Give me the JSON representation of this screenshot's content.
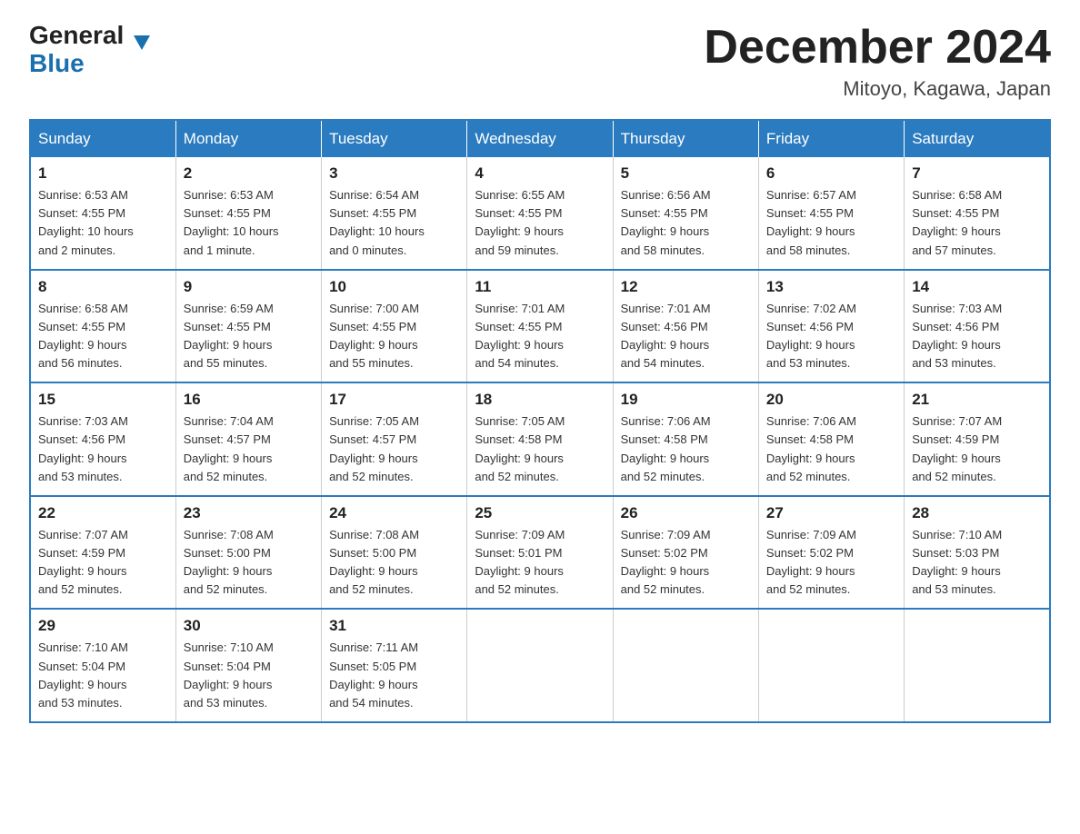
{
  "logo": {
    "general": "General",
    "blue": "Blue",
    "arrow": "▼"
  },
  "header": {
    "title": "December 2024",
    "location": "Mitoyo, Kagawa, Japan"
  },
  "days_of_week": [
    "Sunday",
    "Monday",
    "Tuesday",
    "Wednesday",
    "Thursday",
    "Friday",
    "Saturday"
  ],
  "weeks": [
    [
      {
        "day": "1",
        "sunrise": "6:53 AM",
        "sunset": "4:55 PM",
        "daylight": "10 hours and 2 minutes."
      },
      {
        "day": "2",
        "sunrise": "6:53 AM",
        "sunset": "4:55 PM",
        "daylight": "10 hours and 1 minute."
      },
      {
        "day": "3",
        "sunrise": "6:54 AM",
        "sunset": "4:55 PM",
        "daylight": "10 hours and 0 minutes."
      },
      {
        "day": "4",
        "sunrise": "6:55 AM",
        "sunset": "4:55 PM",
        "daylight": "9 hours and 59 minutes."
      },
      {
        "day": "5",
        "sunrise": "6:56 AM",
        "sunset": "4:55 PM",
        "daylight": "9 hours and 58 minutes."
      },
      {
        "day": "6",
        "sunrise": "6:57 AM",
        "sunset": "4:55 PM",
        "daylight": "9 hours and 58 minutes."
      },
      {
        "day": "7",
        "sunrise": "6:58 AM",
        "sunset": "4:55 PM",
        "daylight": "9 hours and 57 minutes."
      }
    ],
    [
      {
        "day": "8",
        "sunrise": "6:58 AM",
        "sunset": "4:55 PM",
        "daylight": "9 hours and 56 minutes."
      },
      {
        "day": "9",
        "sunrise": "6:59 AM",
        "sunset": "4:55 PM",
        "daylight": "9 hours and 55 minutes."
      },
      {
        "day": "10",
        "sunrise": "7:00 AM",
        "sunset": "4:55 PM",
        "daylight": "9 hours and 55 minutes."
      },
      {
        "day": "11",
        "sunrise": "7:01 AM",
        "sunset": "4:55 PM",
        "daylight": "9 hours and 54 minutes."
      },
      {
        "day": "12",
        "sunrise": "7:01 AM",
        "sunset": "4:56 PM",
        "daylight": "9 hours and 54 minutes."
      },
      {
        "day": "13",
        "sunrise": "7:02 AM",
        "sunset": "4:56 PM",
        "daylight": "9 hours and 53 minutes."
      },
      {
        "day": "14",
        "sunrise": "7:03 AM",
        "sunset": "4:56 PM",
        "daylight": "9 hours and 53 minutes."
      }
    ],
    [
      {
        "day": "15",
        "sunrise": "7:03 AM",
        "sunset": "4:56 PM",
        "daylight": "9 hours and 53 minutes."
      },
      {
        "day": "16",
        "sunrise": "7:04 AM",
        "sunset": "4:57 PM",
        "daylight": "9 hours and 52 minutes."
      },
      {
        "day": "17",
        "sunrise": "7:05 AM",
        "sunset": "4:57 PM",
        "daylight": "9 hours and 52 minutes."
      },
      {
        "day": "18",
        "sunrise": "7:05 AM",
        "sunset": "4:58 PM",
        "daylight": "9 hours and 52 minutes."
      },
      {
        "day": "19",
        "sunrise": "7:06 AM",
        "sunset": "4:58 PM",
        "daylight": "9 hours and 52 minutes."
      },
      {
        "day": "20",
        "sunrise": "7:06 AM",
        "sunset": "4:58 PM",
        "daylight": "9 hours and 52 minutes."
      },
      {
        "day": "21",
        "sunrise": "7:07 AM",
        "sunset": "4:59 PM",
        "daylight": "9 hours and 52 minutes."
      }
    ],
    [
      {
        "day": "22",
        "sunrise": "7:07 AM",
        "sunset": "4:59 PM",
        "daylight": "9 hours and 52 minutes."
      },
      {
        "day": "23",
        "sunrise": "7:08 AM",
        "sunset": "5:00 PM",
        "daylight": "9 hours and 52 minutes."
      },
      {
        "day": "24",
        "sunrise": "7:08 AM",
        "sunset": "5:00 PM",
        "daylight": "9 hours and 52 minutes."
      },
      {
        "day": "25",
        "sunrise": "7:09 AM",
        "sunset": "5:01 PM",
        "daylight": "9 hours and 52 minutes."
      },
      {
        "day": "26",
        "sunrise": "7:09 AM",
        "sunset": "5:02 PM",
        "daylight": "9 hours and 52 minutes."
      },
      {
        "day": "27",
        "sunrise": "7:09 AM",
        "sunset": "5:02 PM",
        "daylight": "9 hours and 52 minutes."
      },
      {
        "day": "28",
        "sunrise": "7:10 AM",
        "sunset": "5:03 PM",
        "daylight": "9 hours and 53 minutes."
      }
    ],
    [
      {
        "day": "29",
        "sunrise": "7:10 AM",
        "sunset": "5:04 PM",
        "daylight": "9 hours and 53 minutes."
      },
      {
        "day": "30",
        "sunrise": "7:10 AM",
        "sunset": "5:04 PM",
        "daylight": "9 hours and 53 minutes."
      },
      {
        "day": "31",
        "sunrise": "7:11 AM",
        "sunset": "5:05 PM",
        "daylight": "9 hours and 54 minutes."
      },
      null,
      null,
      null,
      null
    ]
  ],
  "labels": {
    "sunrise": "Sunrise:",
    "sunset": "Sunset:",
    "daylight": "Daylight:"
  }
}
